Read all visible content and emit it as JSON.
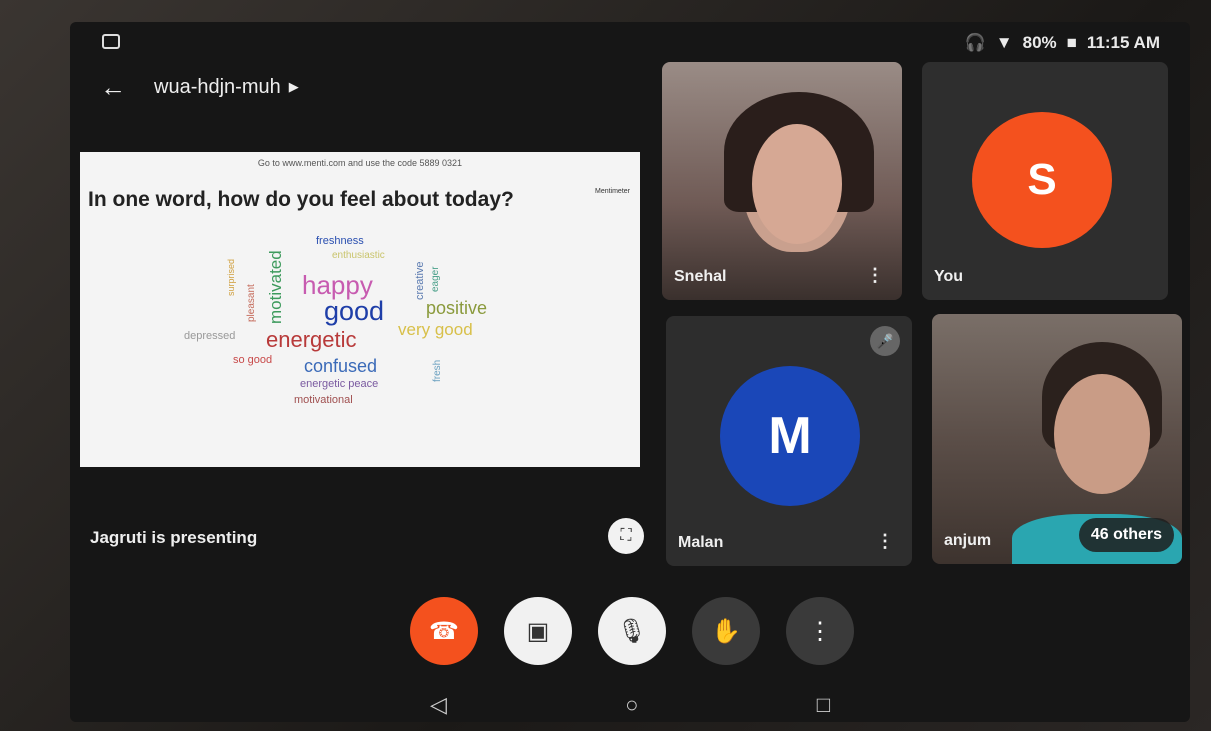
{
  "status_bar": {
    "battery": "80%",
    "time": "11:15 AM"
  },
  "header": {
    "meeting_code": "wua-hdjn-muh"
  },
  "presentation": {
    "hint": "Go to www.menti.com and use the code 5889 0321",
    "brand": "Mentimeter",
    "question": "In one word, how do you feel about today?",
    "words": [
      "freshness",
      "enthusiastic",
      "motivated",
      "pleasant",
      "creative",
      "eager",
      "happy",
      "good",
      "positive",
      "very good",
      "energetic",
      "depressed",
      "so good",
      "confused",
      "fresh",
      "energetic peace",
      "motivational",
      "surprised"
    ],
    "presenting_label": "Jagruti is presenting"
  },
  "participants": {
    "tile1_name": "Snehal",
    "tile2_name": "You",
    "tile2_initial": "S",
    "tile3_name": "Malan",
    "tile3_initial": "M",
    "tile4_name": "anjum",
    "others": "46 others"
  },
  "colors": {
    "end_call": "#f4511e",
    "avatar_you": "#f4511e",
    "avatar_malan": "#1a47b8"
  }
}
